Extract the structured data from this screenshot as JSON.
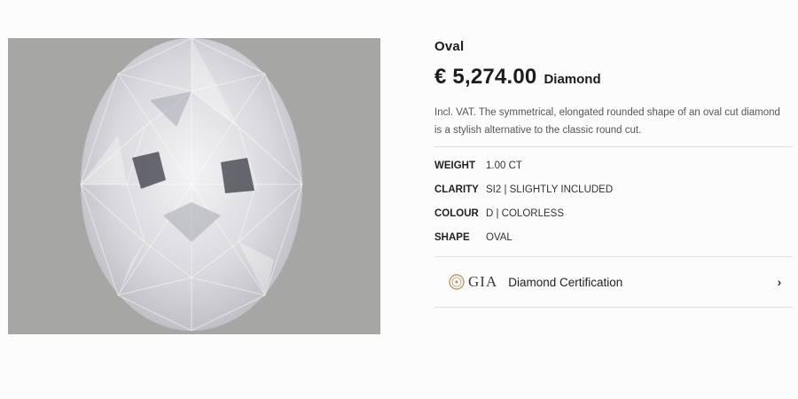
{
  "product": {
    "title": "Oval",
    "price": "€ 5,274.00",
    "price_suffix": "Diamond",
    "description": "Incl. VAT. The symmetrical, elongated rounded shape of an oval cut diamond is a stylish alternative to the classic round cut."
  },
  "specs": [
    {
      "label": "WEIGHT",
      "value": "1.00 CT"
    },
    {
      "label": "CLARITY",
      "value": "SI2 | SLIGHTLY INCLUDED"
    },
    {
      "label": "COLOUR",
      "value": "D | COLORLESS"
    },
    {
      "label": "SHAPE",
      "value": "OVAL"
    }
  ],
  "certification": {
    "logo_text": "GIA",
    "label": "Diamond Certification",
    "icon": "chevron-right-icon"
  },
  "colors": {
    "image_background": "#a6a6a4",
    "text": "#1c1c1c",
    "divider": "#e2e2e2"
  }
}
